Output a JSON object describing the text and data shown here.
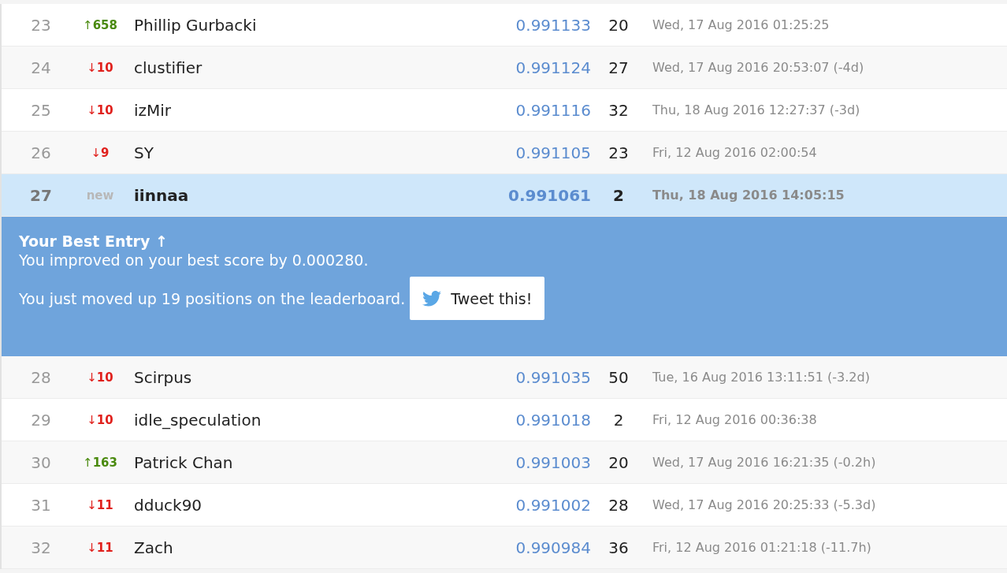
{
  "rows": [
    {
      "rank": "23",
      "movement": {
        "kind": "up",
        "arrow": "↑",
        "amount": "658"
      },
      "name": "Phillip Gurbacki",
      "score": "0.991133",
      "entries": "20",
      "last_submission": "Wed, 17 Aug 2016 01:25:25",
      "selected": false
    },
    {
      "rank": "24",
      "movement": {
        "kind": "down",
        "arrow": "↓",
        "amount": "10"
      },
      "name": "clustifier",
      "score": "0.991124",
      "entries": "27",
      "last_submission": "Wed, 17 Aug 2016 20:53:07 (-4d)",
      "selected": false
    },
    {
      "rank": "25",
      "movement": {
        "kind": "down",
        "arrow": "↓",
        "amount": "10"
      },
      "name": "izMir",
      "score": "0.991116",
      "entries": "32",
      "last_submission": "Thu, 18 Aug 2016 12:27:37 (-3d)",
      "selected": false
    },
    {
      "rank": "26",
      "movement": {
        "kind": "down",
        "arrow": "↓",
        "amount": "9"
      },
      "name": "SY",
      "score": "0.991105",
      "entries": "23",
      "last_submission": "Fri, 12 Aug 2016 02:00:54",
      "selected": false
    },
    {
      "rank": "27",
      "movement": {
        "kind": "new",
        "label": "new"
      },
      "name": "iinnaa",
      "score": "0.991061",
      "entries": "2",
      "last_submission": "Thu, 18 Aug 2016 14:05:15",
      "selected": true
    },
    {
      "rank": "28",
      "movement": {
        "kind": "down",
        "arrow": "↓",
        "amount": "10"
      },
      "name": "Scirpus",
      "score": "0.991035",
      "entries": "50",
      "last_submission": "Tue, 16 Aug 2016 13:11:51 (-3.2d)",
      "selected": false
    },
    {
      "rank": "29",
      "movement": {
        "kind": "down",
        "arrow": "↓",
        "amount": "10"
      },
      "name": "idle_speculation",
      "score": "0.991018",
      "entries": "2",
      "last_submission": "Fri, 12 Aug 2016 00:36:38",
      "selected": false
    },
    {
      "rank": "30",
      "movement": {
        "kind": "up",
        "arrow": "↑",
        "amount": "163"
      },
      "name": "Patrick Chan",
      "score": "0.991003",
      "entries": "20",
      "last_submission": "Wed, 17 Aug 2016 16:21:35 (-0.2h)",
      "selected": false
    },
    {
      "rank": "31",
      "movement": {
        "kind": "down",
        "arrow": "↓",
        "amount": "11"
      },
      "name": "dduck90",
      "score": "0.991002",
      "entries": "28",
      "last_submission": "Wed, 17 Aug 2016 20:25:33 (-5.3d)",
      "selected": false
    },
    {
      "rank": "32",
      "movement": {
        "kind": "down",
        "arrow": "↓",
        "amount": "11"
      },
      "name": "Zach",
      "score": "0.990984",
      "entries": "36",
      "last_submission": "Fri, 12 Aug 2016 01:21:18 (-11.7h)",
      "selected": false
    }
  ],
  "banner": {
    "title": "Your Best Entry ↑",
    "improvement": "You improved on your best score by 0.000280.",
    "position_change": "You just moved up 19 positions on the leaderboard.",
    "tweet_button": "Tweet this!"
  }
}
